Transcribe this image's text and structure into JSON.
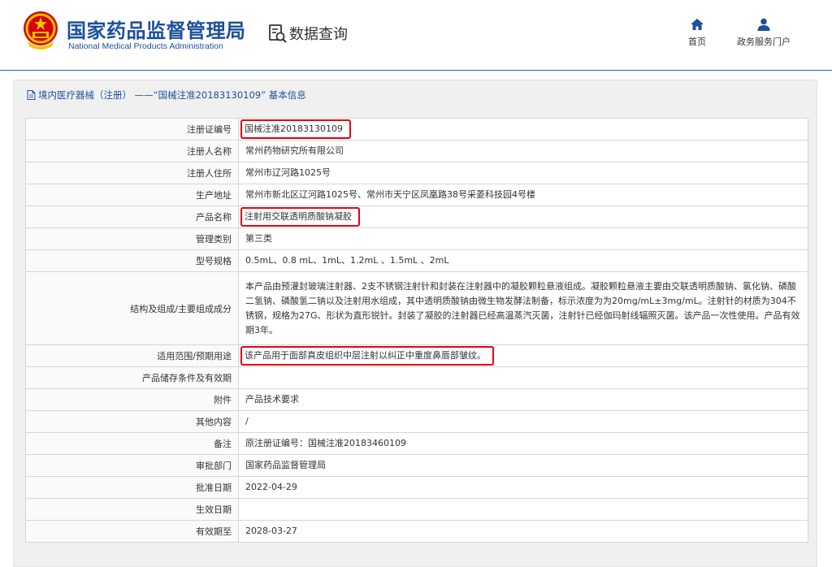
{
  "header": {
    "agency_cn": "国家药品监督管理局",
    "agency_en": "National Medical Products Administration",
    "data_query": "数据查询",
    "nav": [
      {
        "label": "首页",
        "icon": "home-icon"
      },
      {
        "label": "政务服务门户",
        "icon": "user-icon"
      }
    ]
  },
  "breadcrumb": "境内医疗器械（注册） ——“国械注准20183130109” 基本信息",
  "colors": {
    "brand": "#1d4f9c",
    "highlight": "#e60012"
  },
  "rows": [
    {
      "label": "注册证编号",
      "value": "国械注准20183130109",
      "highlight": true
    },
    {
      "label": "注册人名称",
      "value": "常州药物研究所有限公司"
    },
    {
      "label": "注册人住所",
      "value": "常州市辽河路1025号"
    },
    {
      "label": "生产地址",
      "value": "常州市新北区辽河路1025号、常州市天宁区凤凰路38号采菱科技园4号楼"
    },
    {
      "label": "产品名称",
      "value": "注射用交联透明质酸钠凝胶",
      "highlight": true
    },
    {
      "label": "管理类别",
      "value": "第三类"
    },
    {
      "label": "型号规格",
      "value": "0.5mL、0.8 mL、1mL、1.2mL 、1.5mL 、2mL"
    },
    {
      "label": "结构及组成/主要组成成分",
      "value": "本产品由预灌封玻璃注射器、2支不锈钢注射针和封装在注射器中的凝胶颗粒悬液组成。凝胶颗粒悬液主要由交联透明质酸钠、氯化钠、磷酸二氢钠、磷酸氢二钠以及注射用水组成，其中透明质酸钠由微生物发酵法制备，标示浓度为为20mg/mL±3mg/mL。注射针的材质为304不锈钢，规格为27G、形状为直形锐针。封装了凝胶的注射器已经高温蒸汽灭菌，注射针已经伽玛射线辐照灭菌。该产品一次性使用。产品有效期3年。",
      "tall": true
    },
    {
      "label": "适用范围/预期用途",
      "value": "该产品用于面部真皮组织中层注射以纠正中重度鼻唇部皱纹。",
      "highlight": true
    },
    {
      "label": "产品储存条件及有效期",
      "value": ""
    },
    {
      "label": "附件",
      "value": "产品技术要求"
    },
    {
      "label": "其他内容",
      "value": "/"
    },
    {
      "label": "备注",
      "value": "原注册证编号：国械注准20183460109"
    },
    {
      "label": "审批部门",
      "value": "国家药品监督管理局"
    },
    {
      "label": "批准日期",
      "value": "2022-04-29"
    },
    {
      "label": "生效日期",
      "value": ""
    },
    {
      "label": "有效期至",
      "value": "2028-03-27"
    }
  ]
}
